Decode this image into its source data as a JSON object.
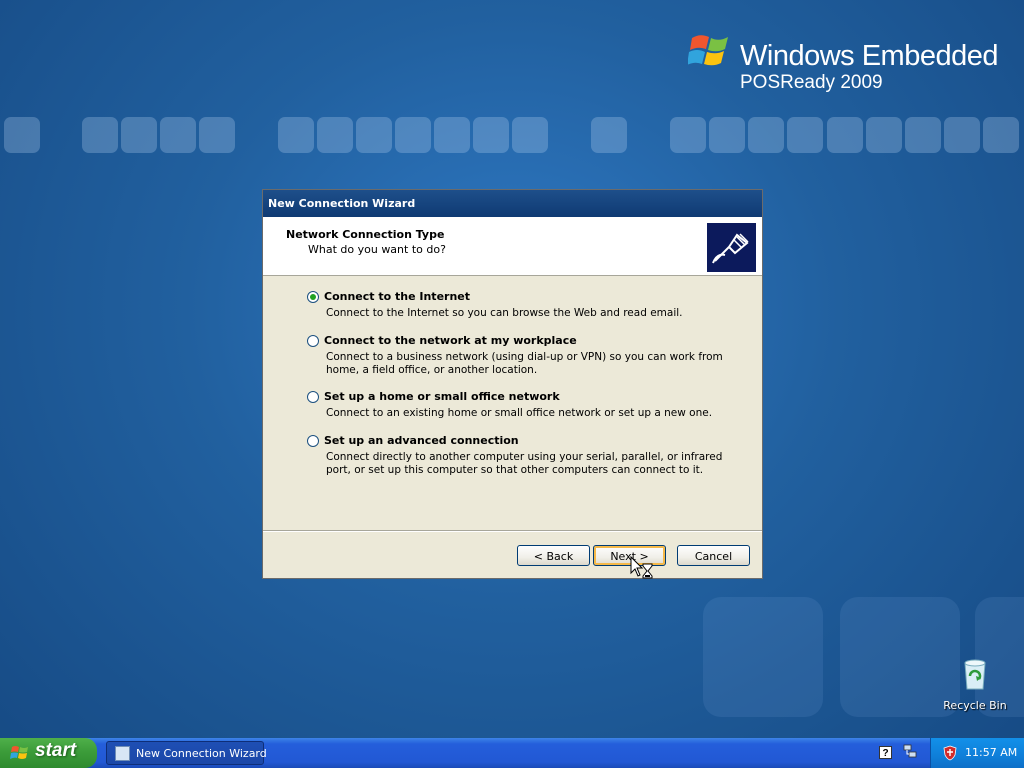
{
  "branding": {
    "line1": "Windows Embedded",
    "line2": "POSReady 2009"
  },
  "dialog": {
    "title": "New Connection Wizard",
    "header_title": "Network Connection Type",
    "header_subtitle": "What do you want to do?",
    "header_icon": "network-cable-icon",
    "options": [
      {
        "label": "Connect to the Internet",
        "description": "Connect to the Internet so you can browse the Web and read email.",
        "checked": true
      },
      {
        "label": "Connect to the network at my workplace",
        "description": "Connect to a business network (using dial-up or VPN) so you can work from home, a field office, or another location.",
        "checked": false
      },
      {
        "label": "Set up a home or small office network",
        "description": "Connect to an existing home or small office network or set up a new one.",
        "checked": false
      },
      {
        "label": "Set up an advanced connection",
        "description": "Connect directly to another computer using your serial, parallel, or infrared port, or set up this computer so that other computers can connect to it.",
        "checked": false
      }
    ],
    "back_label": "< Back",
    "next_label": "Next >",
    "cancel_label": "Cancel"
  },
  "desktop": {
    "recycle_bin_label": "Recycle Bin"
  },
  "taskbar": {
    "start_label": "start",
    "task_button_label": "New Connection Wizard",
    "clock": "11:57 AM",
    "help_glyph": "?"
  },
  "colors": {
    "title_bar": "#0f3a73",
    "dialog_face": "#ece9d8",
    "taskbar": "#245edb",
    "start_button": "#3c9c3a",
    "tray": "#0f7fd9"
  }
}
